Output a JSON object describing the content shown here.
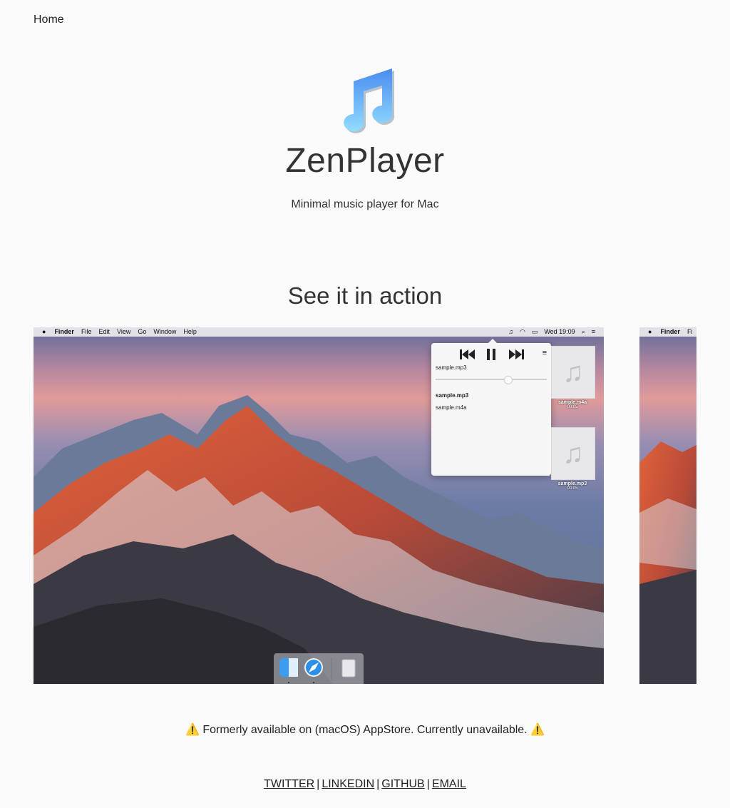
{
  "nav": {
    "home_label": "Home"
  },
  "hero": {
    "title": "ZenPlayer",
    "tagline": "Minimal music player for Mac",
    "logo_icon": "music-note-icon",
    "logo_colors": [
      "#5aa8ff",
      "#8fd4ff"
    ]
  },
  "section": {
    "heading": "See it in action"
  },
  "screenshot": {
    "menubar": {
      "app_name": "Finder",
      "menus": [
        "File",
        "Edit",
        "View",
        "Go",
        "Window",
        "Help"
      ],
      "clock": "Wed 19:09",
      "status_icons": [
        "music-note-icon",
        "wifi-icon",
        "battery-icon",
        "search-icon",
        "list-icon"
      ]
    },
    "player": {
      "now_playing": "sample.mp3",
      "progress": 0.65,
      "playlist": [
        {
          "name": "sample.mp3",
          "active": true
        },
        {
          "name": "sample.m4a",
          "active": false
        }
      ]
    },
    "desktop_files": [
      {
        "name": "sample.m4a",
        "duration": "00:05"
      },
      {
        "name": "sample.mp3",
        "duration": "00:05"
      }
    ],
    "next_preview": {
      "app_name": "Finder",
      "menu_partial": "Fi"
    }
  },
  "notice": {
    "text": "⚠️ Formerly available on (macOS) AppStore. Currently unavailable. ⚠️"
  },
  "footer": {
    "links": [
      {
        "label": "TWITTER"
      },
      {
        "label": "LINKEDIN"
      },
      {
        "label": "GITHUB"
      },
      {
        "label": "EMAIL"
      }
    ],
    "separator": "|"
  }
}
